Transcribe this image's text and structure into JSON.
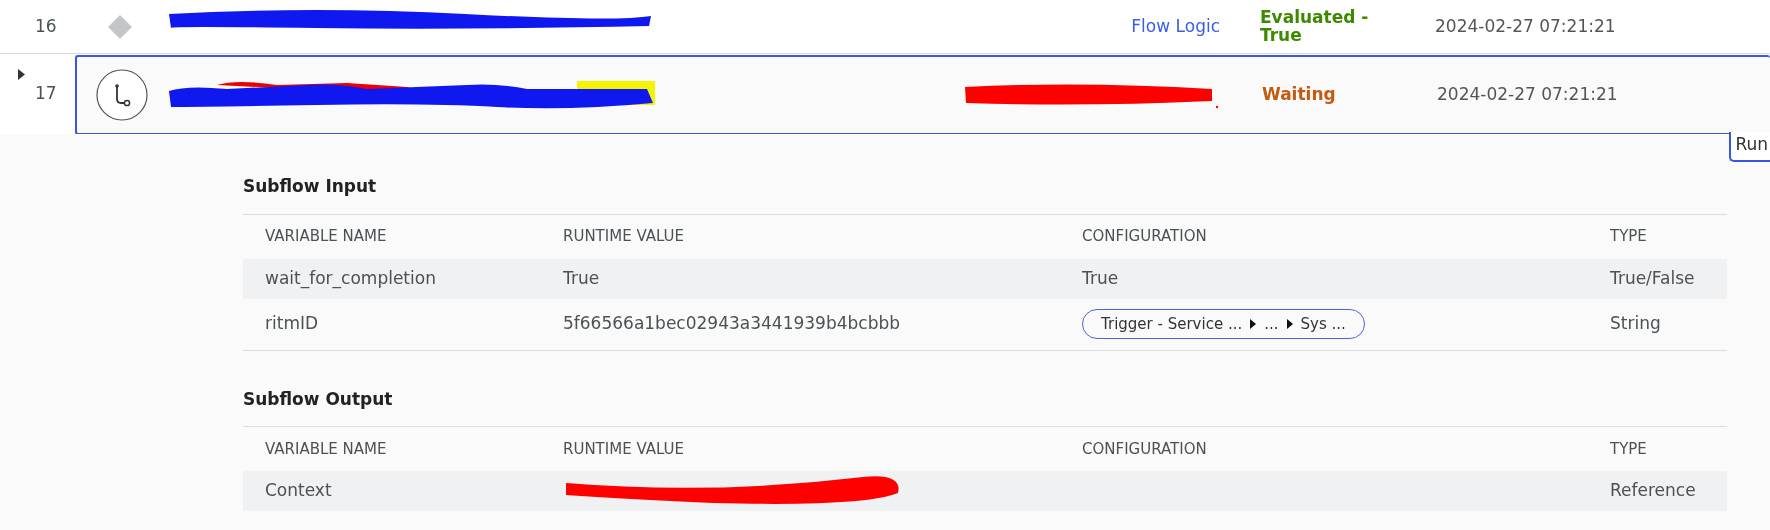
{
  "rows": [
    {
      "number": "16",
      "kind": "diamond",
      "link": "Flow Logic",
      "status": "Evaluated - True",
      "color": "#3c8a00",
      "time": "2024-02-27 07:21:21",
      "expanded": false,
      "selected": false
    },
    {
      "number": "17",
      "kind": "subflow",
      "link": "",
      "status": "Waiting",
      "color": "#c55a0e",
      "time": "2024-02-27 07:21:21",
      "expanded": true,
      "selected": true
    }
  ],
  "run_tab": "Run",
  "sections": [
    {
      "title": "Subflow Input",
      "columns": [
        "VARIABLE NAME",
        "RUNTIME VALUE",
        "CONFIGURATION",
        "TYPE"
      ],
      "rows": [
        {
          "name": "wait_for_completion",
          "value": "True",
          "redacted": false,
          "configuration": {
            "kind": "text",
            "text": "True"
          },
          "type": "True/False"
        },
        {
          "name": "ritmID",
          "value": "5f66566a1bec02943a3441939b4bcbbb",
          "redacted": false,
          "configuration": {
            "kind": "pill",
            "parts": [
              "Trigger - Service ...",
              "...",
              "Sys ..."
            ]
          },
          "type": "String"
        }
      ]
    },
    {
      "title": "Subflow Output",
      "columns": [
        "VARIABLE NAME",
        "RUNTIME VALUE",
        "CONFIGURATION",
        "TYPE"
      ],
      "rows": [
        {
          "name": "Context",
          "redacted": true,
          "configuration": {
            "kind": "empty"
          },
          "type": "Reference"
        }
      ]
    }
  ]
}
